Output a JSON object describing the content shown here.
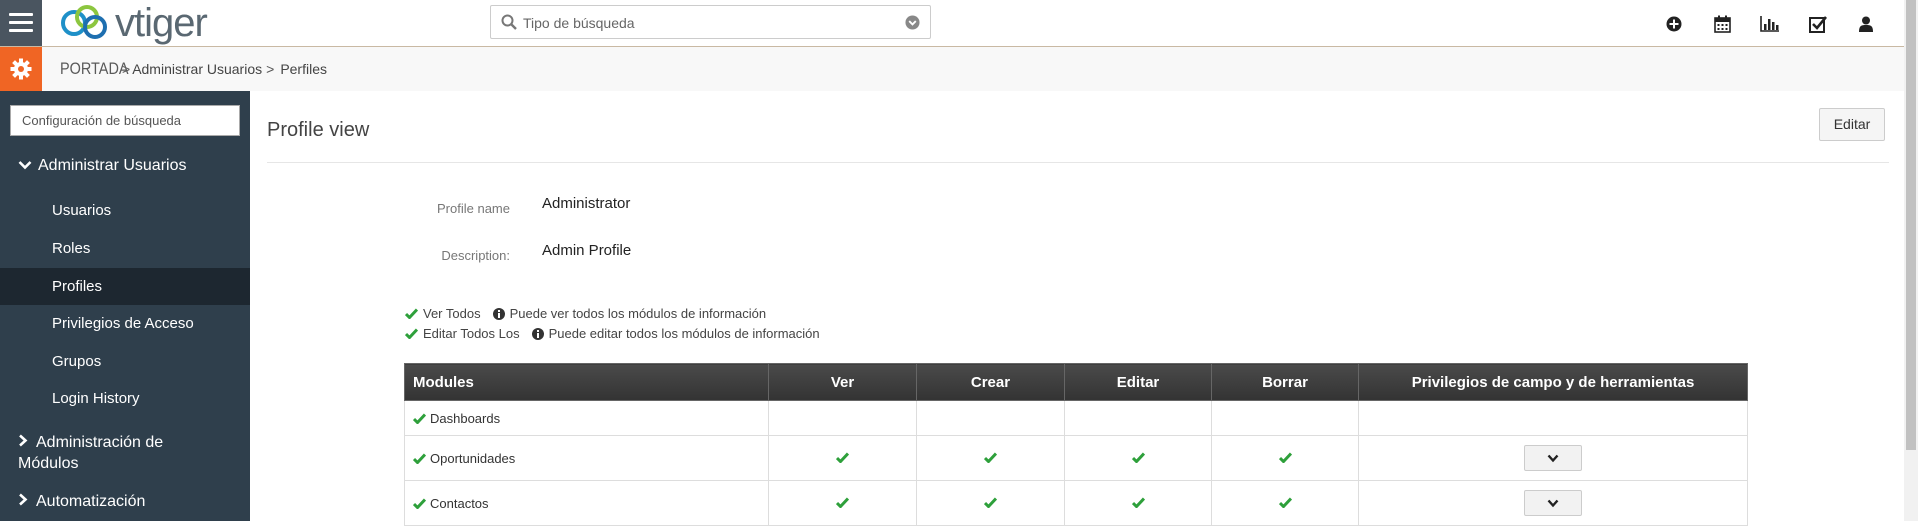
{
  "app": {
    "logo_text": "vtiger"
  },
  "search": {
    "placeholder": "Tipo de búsqueda"
  },
  "top_icons": [
    "plus-circle-icon",
    "calendar-icon",
    "bar-chart-icon",
    "checkbox-icon",
    "user-icon"
  ],
  "breadcrumb": {
    "home": "PORTADA",
    "sep": ">",
    "items": [
      "Administrar Usuarios",
      "Perfiles"
    ]
  },
  "sidebar": {
    "search_placeholder": "Configuración de búsqueda",
    "group_users": "Administrar Usuarios",
    "items": [
      {
        "label": "Usuarios"
      },
      {
        "label": "Roles"
      },
      {
        "label": "Profiles"
      },
      {
        "label": "Privilegios de Acceso"
      },
      {
        "label": "Grupos"
      },
      {
        "label": "Login History"
      }
    ],
    "group_modules_line1": "Administración de",
    "group_modules_line2": "Módulos",
    "group_automation": "Automatización"
  },
  "main": {
    "title": "Profile view",
    "edit_label": "Editar",
    "profile_name_label": "Profile name",
    "profile_name_value": "Administrator",
    "description_label": "Description:",
    "description_value": "Admin Profile",
    "perms": [
      {
        "label": "Ver Todos",
        "info": "Puede ver todos los módulos de información"
      },
      {
        "label": "Editar Todos Los",
        "info": "Puede editar todos los módulos de información"
      }
    ]
  },
  "table": {
    "headers": [
      "Modules",
      "Ver",
      "Crear",
      "Editar",
      "Borrar",
      "Privilegios de campo y de herramientas"
    ],
    "rows": [
      {
        "module": "Dashboards",
        "ver": false,
        "crear": false,
        "editar": false,
        "borrar": false,
        "expand": false
      },
      {
        "module": "Oportunidades",
        "ver": true,
        "crear": true,
        "editar": true,
        "borrar": true,
        "expand": true
      },
      {
        "module": "Contactos",
        "ver": true,
        "crear": true,
        "editar": true,
        "borrar": true,
        "expand": true
      }
    ]
  },
  "colors": {
    "accent": "#f06524",
    "sidebar": "#2f3f4c",
    "check": "#2ea03b"
  }
}
